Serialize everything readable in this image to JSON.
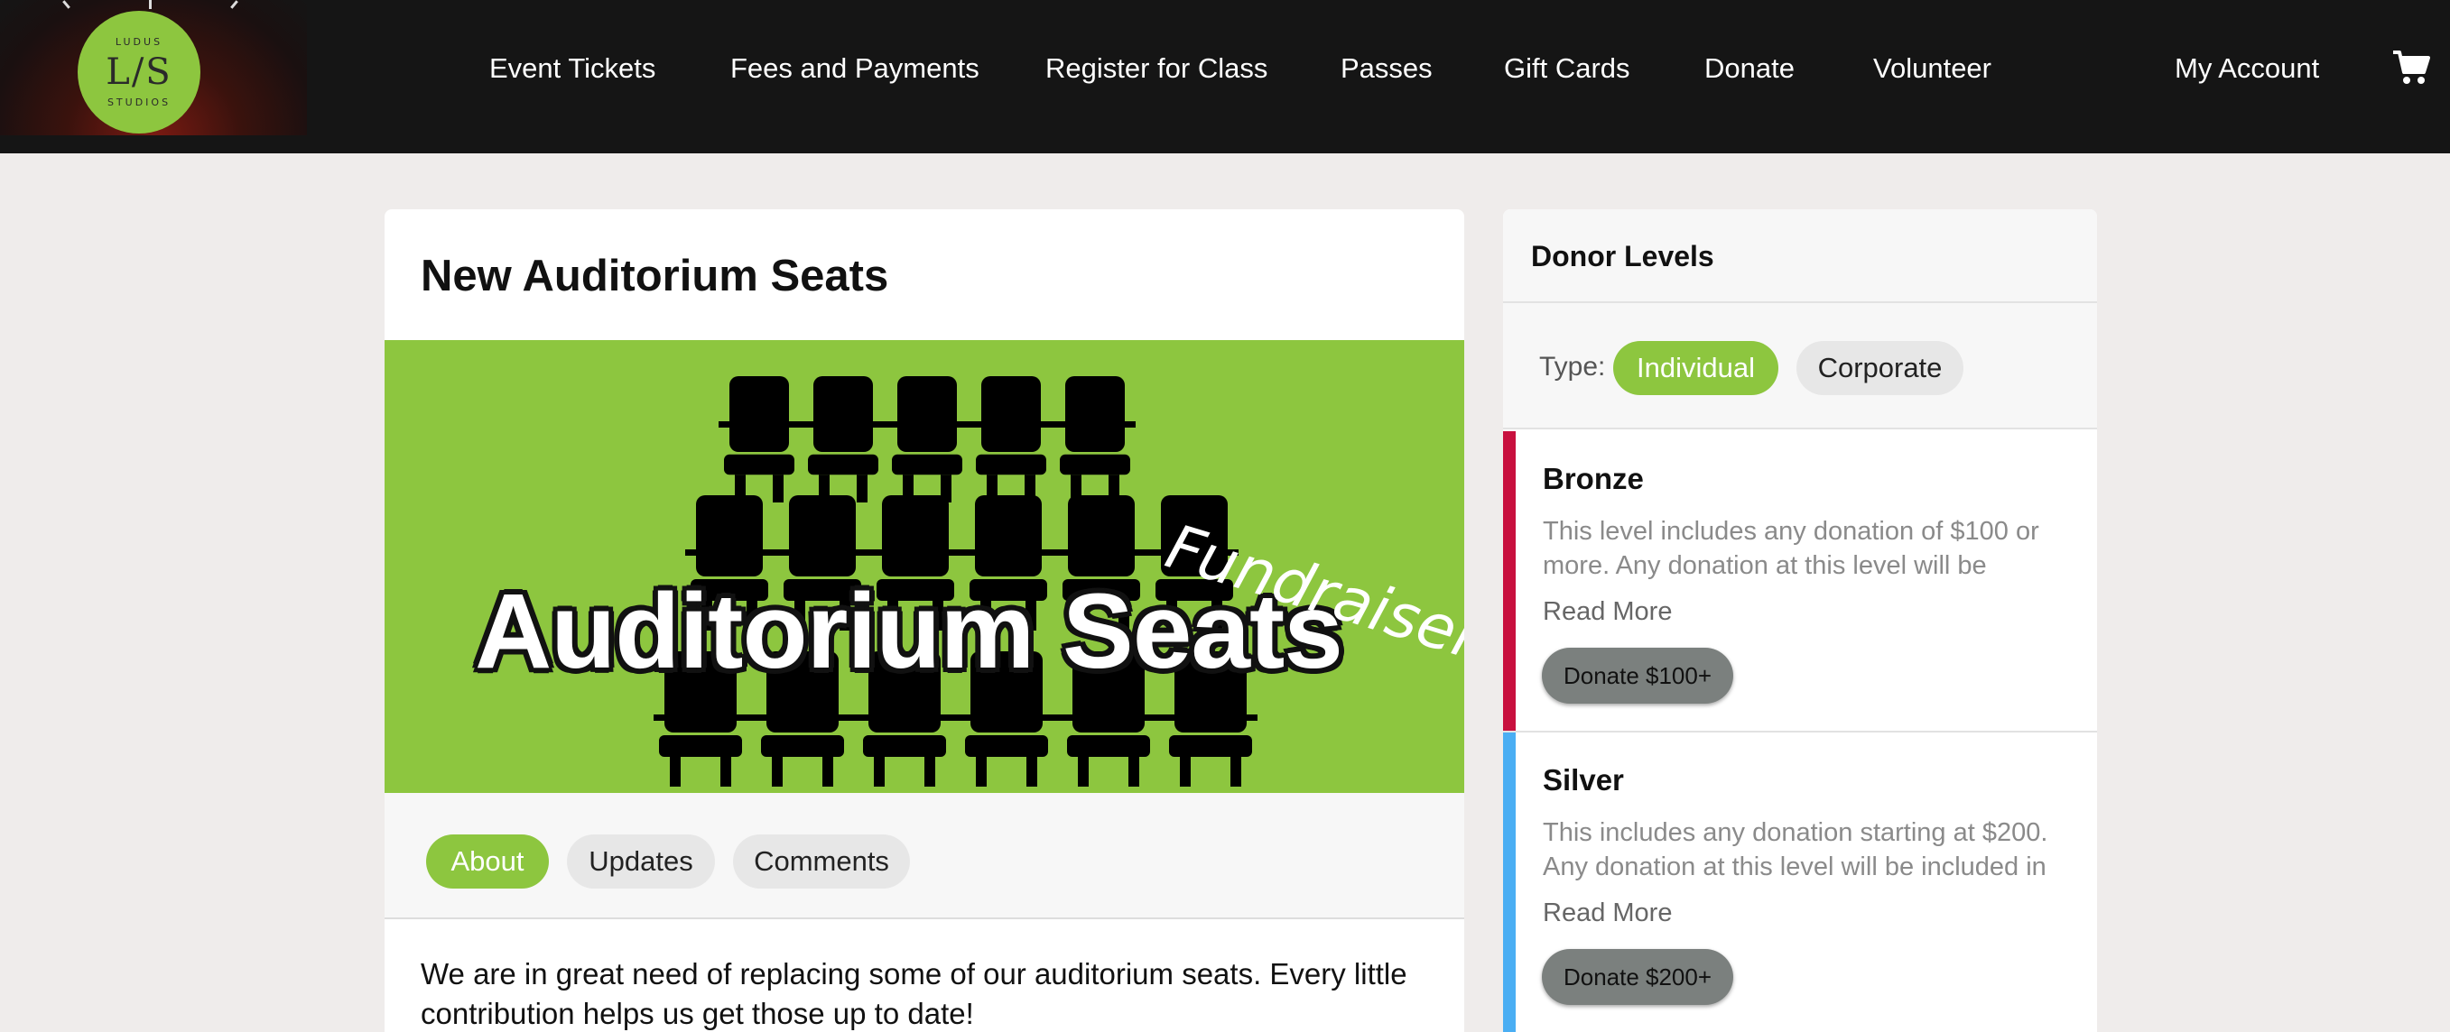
{
  "brand": {
    "logo_top": "LUDUS",
    "logo_mono": "L/S",
    "logo_bottom": "STUDIOS",
    "accent": "#8dc63f"
  },
  "nav": {
    "items": [
      {
        "label": "Event Tickets"
      },
      {
        "label": "Fees and Payments"
      },
      {
        "label": "Register for Class"
      },
      {
        "label": "Passes"
      },
      {
        "label": "Gift Cards"
      },
      {
        "label": "Donate"
      },
      {
        "label": "Volunteer"
      }
    ],
    "account_label": "My Account",
    "cart_icon": "shopping-cart-icon"
  },
  "campaign": {
    "title": "New Auditorium Seats",
    "banner": {
      "main_text": "Auditorium Seats",
      "script_text": "Fundraiser",
      "background": "#8dc63f"
    },
    "tabs": [
      {
        "label": "About",
        "active": true
      },
      {
        "label": "Updates",
        "active": false
      },
      {
        "label": "Comments",
        "active": false
      }
    ],
    "about_text": "We are in great need of replacing some of our auditorium seats. Every little contribution helps us get those up to date!"
  },
  "donor_levels": {
    "heading": "Donor Levels",
    "type_label": "Type:",
    "types": [
      {
        "label": "Individual",
        "active": true
      },
      {
        "label": "Corporate",
        "active": false
      }
    ],
    "levels": [
      {
        "name": "Bronze",
        "color": "#c8103e",
        "description": "This level includes any donation of $100 or more. Any donation at this level will be",
        "read_more": "Read More",
        "button": "Donate $100+"
      },
      {
        "name": "Silver",
        "color": "#4aaef3",
        "description": "This includes any donation starting at $200. Any donation at this level will be included in",
        "read_more": "Read More",
        "button": "Donate $200+"
      }
    ]
  }
}
